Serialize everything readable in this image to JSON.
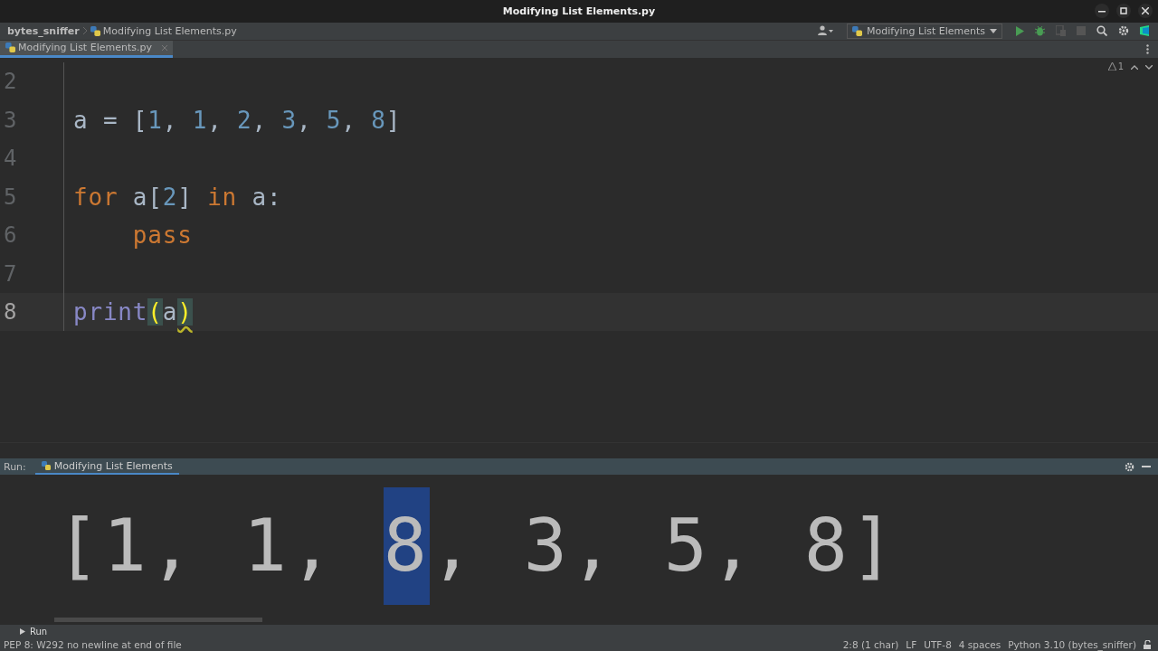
{
  "window": {
    "title": "Modifying List Elements.py"
  },
  "breadcrumbs": [
    "bytes_sniffer",
    "Modifying List Elements.py"
  ],
  "run_config": "Modifying List Elements",
  "editor_tabs": [
    {
      "label": "Modifying List Elements.py",
      "selected": true
    }
  ],
  "inspection": {
    "count": "1"
  },
  "code_lines": [
    {
      "number": "2",
      "current": false
    },
    {
      "number": "3",
      "current": false,
      "tokens": [
        {
          "text": "a = [",
          "kind": "plain"
        },
        {
          "text": "1",
          "kind": "num"
        },
        {
          "text": ", ",
          "kind": "plain"
        },
        {
          "text": "1",
          "kind": "num"
        },
        {
          "text": ", ",
          "kind": "plain"
        },
        {
          "text": "2",
          "kind": "num"
        },
        {
          "text": ", ",
          "kind": "plain"
        },
        {
          "text": "3",
          "kind": "num"
        },
        {
          "text": ", ",
          "kind": "plain"
        },
        {
          "text": "5",
          "kind": "num"
        },
        {
          "text": ", ",
          "kind": "plain"
        },
        {
          "text": "8",
          "kind": "num"
        },
        {
          "text": "]",
          "kind": "plain"
        }
      ]
    },
    {
      "number": "4",
      "current": false
    },
    {
      "number": "5",
      "current": false,
      "tokens": [
        {
          "text": "for",
          "kind": "kw"
        },
        {
          "text": " a[",
          "kind": "plain"
        },
        {
          "text": "2",
          "kind": "num"
        },
        {
          "text": "] ",
          "kind": "plain"
        },
        {
          "text": "in",
          "kind": "kw"
        },
        {
          "text": " a:",
          "kind": "plain"
        }
      ]
    },
    {
      "number": "6",
      "current": false,
      "tokens": [
        {
          "text": "    pass",
          "kind": "kw"
        }
      ]
    },
    {
      "number": "7",
      "current": false
    },
    {
      "number": "8",
      "current": true,
      "tokens": [
        {
          "text": "print",
          "kind": "builtin"
        },
        {
          "text": "(",
          "kind": "match"
        },
        {
          "text": "a",
          "kind": "plain"
        },
        {
          "text": ")",
          "kind": "match-warn"
        }
      ]
    }
  ],
  "run_panel": {
    "label": "Run:",
    "tab": "Modifying List Elements",
    "output": [
      {
        "text": "[1, 1, ",
        "selected": false
      },
      {
        "text": "8",
        "selected": true
      },
      {
        "text": ", 3, 5, 8]",
        "selected": false
      }
    ]
  },
  "tool_button": "Run",
  "status_bar": {
    "message": "PEP 8: W292 no newline at end of file",
    "items": [
      "2:8 (1 char)",
      "LF",
      "UTF-8",
      "4 spaces",
      "Python 3.10 (bytes_sniffer)"
    ]
  }
}
